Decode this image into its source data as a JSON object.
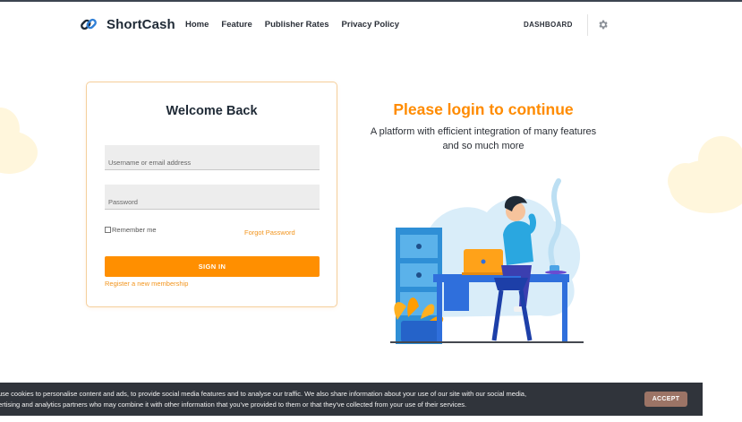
{
  "brand": {
    "name": "ShortCash"
  },
  "nav": {
    "items": [
      {
        "label": "Home"
      },
      {
        "label": "Feature"
      },
      {
        "label": "Publisher Rates"
      },
      {
        "label": "Privacy Policy"
      }
    ],
    "dashboard_label": "DASHBOARD",
    "settings_icon": "gear-icon"
  },
  "login": {
    "title": "Welcome Back",
    "username_placeholder": "Username or email address",
    "username_value": "",
    "password_placeholder": "Password",
    "password_value": "",
    "remember_label": "Remember me",
    "remember_checked": false,
    "forgot_label": "Forgot Password",
    "signin_label": "SIGN IN",
    "register_label": "Register a new membership"
  },
  "hero": {
    "title": "Please login to continue",
    "subtitle_line1": "A platform with efficient integration of many features",
    "subtitle_line2": "and so much more"
  },
  "cookie": {
    "line1": "use cookies to personalise content and ads, to provide social media features and to analyse our traffic. We also share information about your use of our site with our social media,",
    "line2": "ertising and analytics partners who may combine it with other information that you've provided to them or that they've collected from your use of their services.",
    "accept_label": "ACCEPT"
  },
  "colors": {
    "accent": "#ff8f00",
    "card_border": "#f5cf9c",
    "cookie_bg": "#30343b",
    "accept_bg": "#9c7466"
  }
}
